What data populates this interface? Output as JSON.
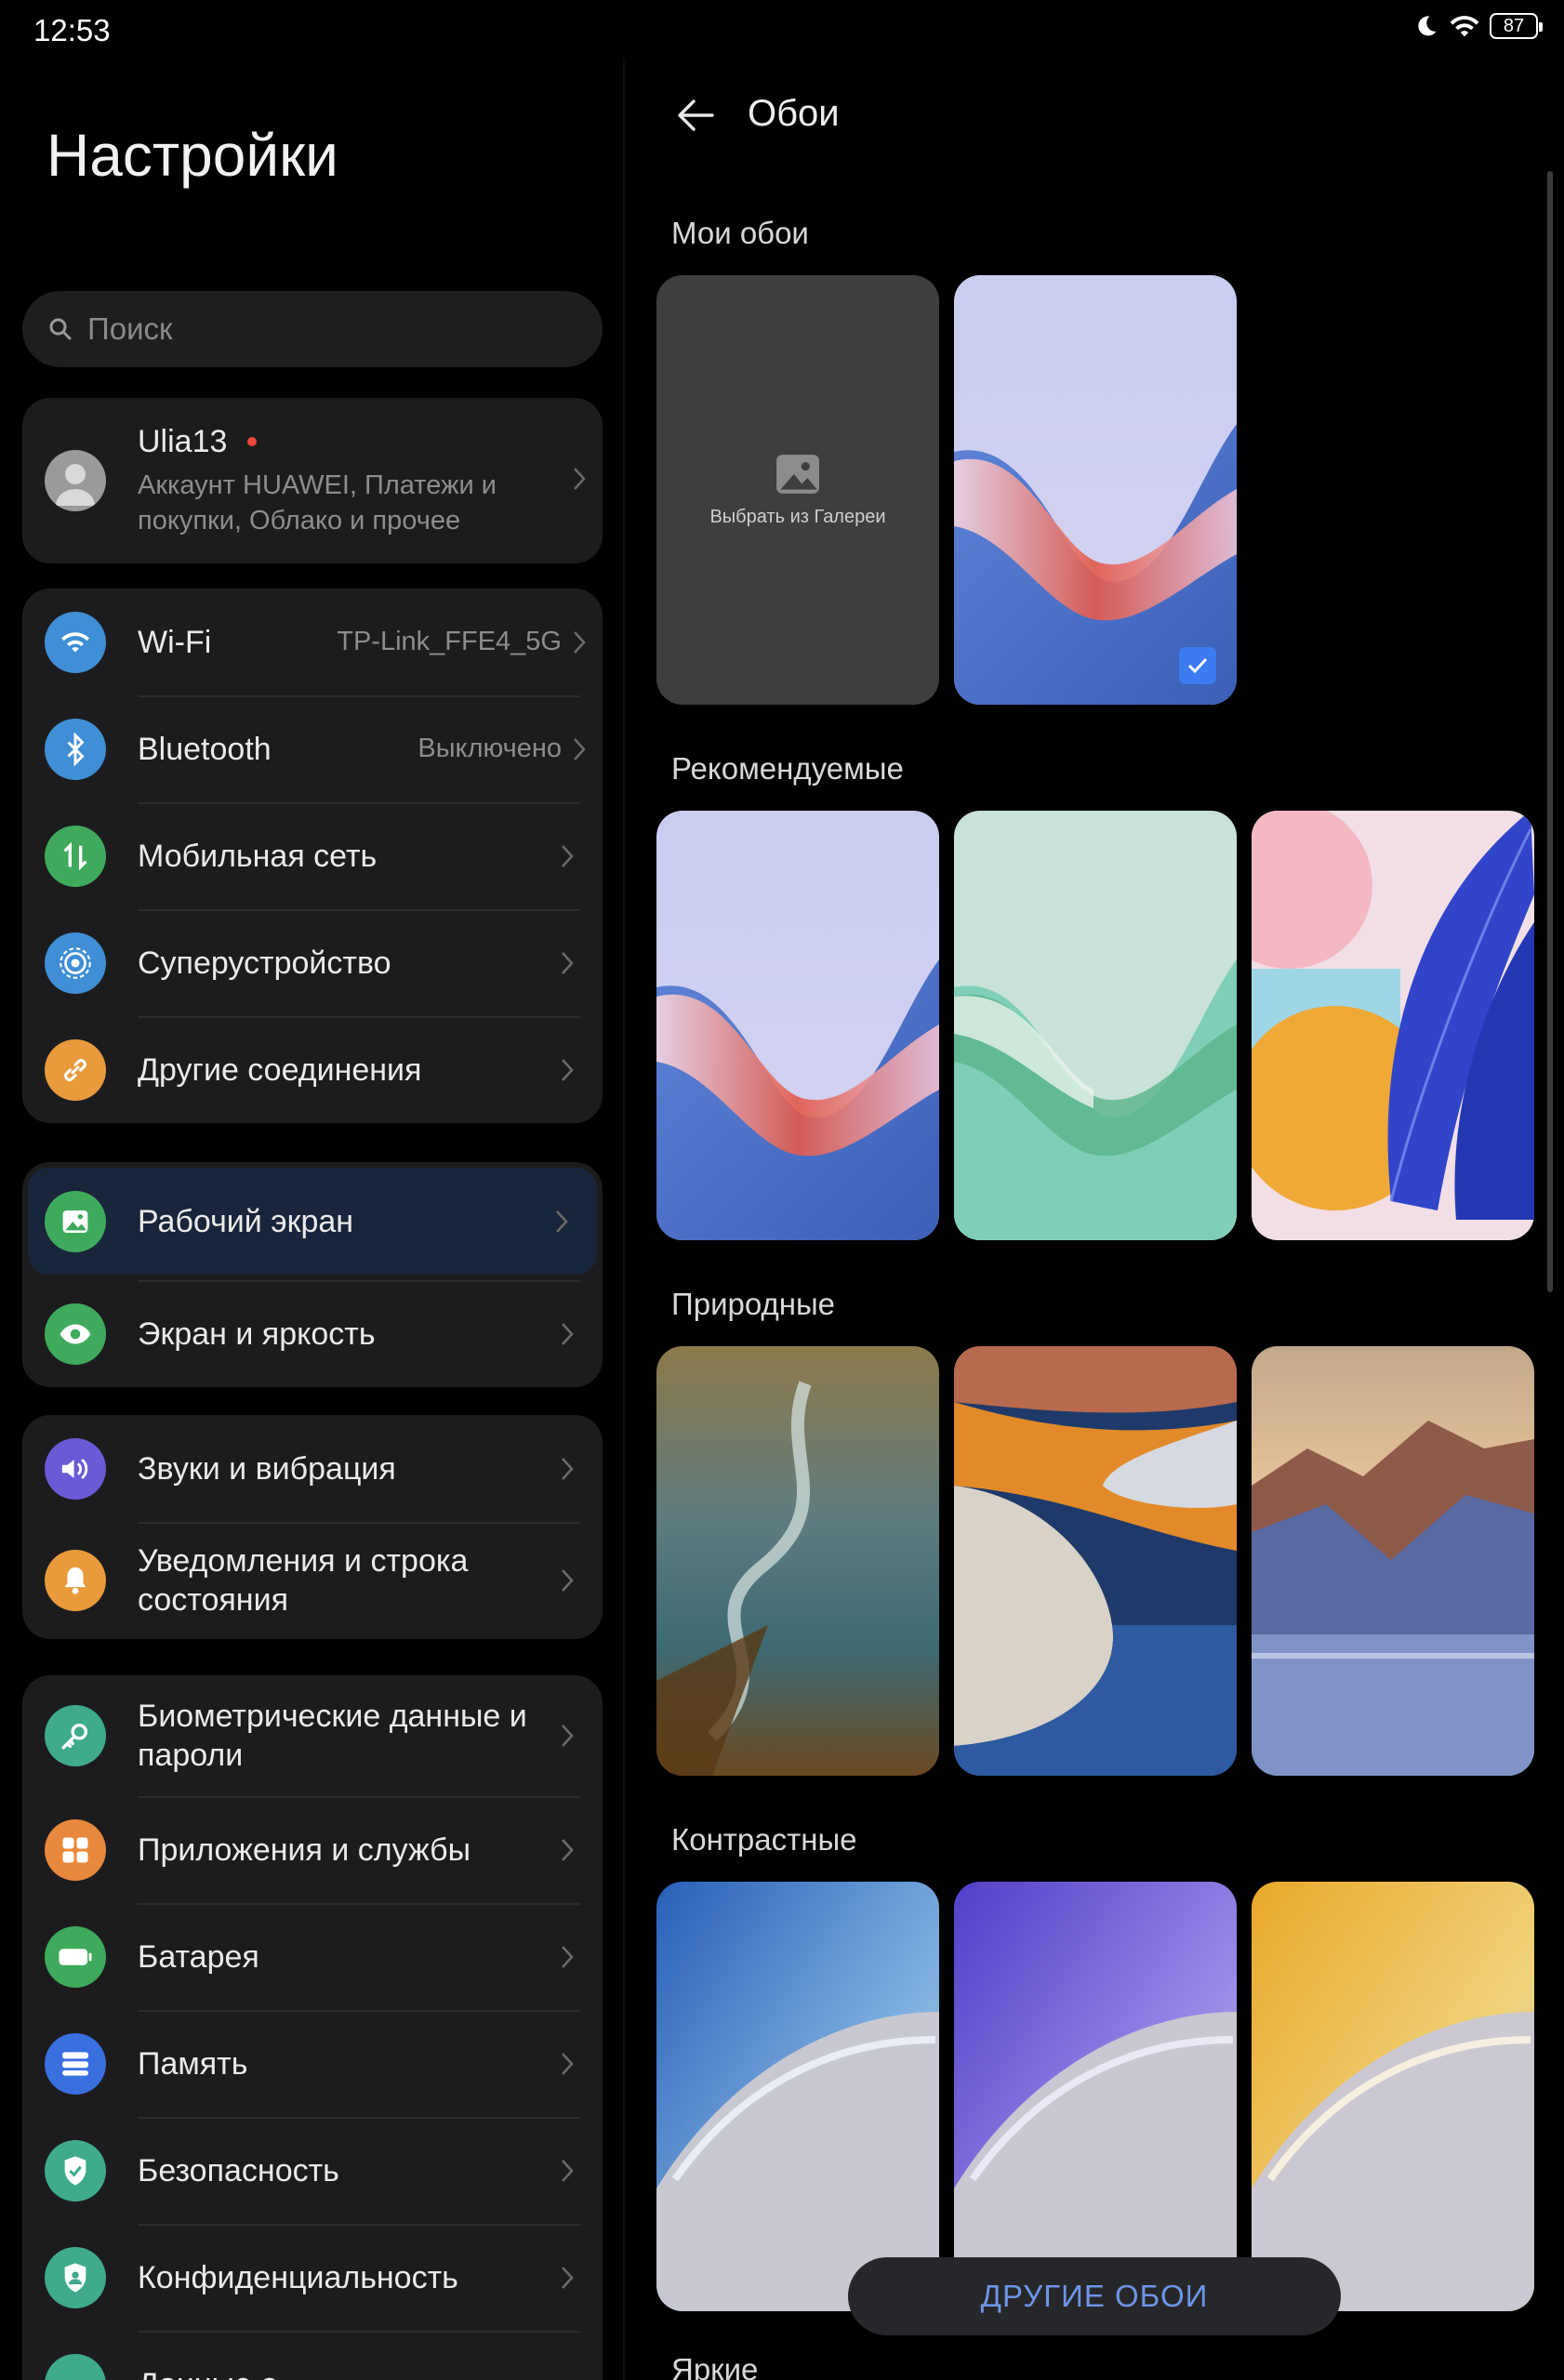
{
  "status": {
    "time": "12:53",
    "battery": "87"
  },
  "settings": {
    "title": "Настройки",
    "search_placeholder": "Поиск",
    "profile": {
      "name": "Ulia13",
      "subtitle_line1": "Аккаунт HUAWEI, Платежи и",
      "subtitle_line2": "покупки, Облако и прочее"
    },
    "items": {
      "wifi": {
        "label": "Wi-Fi",
        "value": "TP-Link_FFE4_5G"
      },
      "bluetooth": {
        "label": "Bluetooth",
        "value": "Выключено"
      },
      "mobile": {
        "label": "Мобильная сеть"
      },
      "super": {
        "label": "Суперустройство"
      },
      "other": {
        "label": "Другие соединения"
      },
      "home": {
        "label": "Рабочий экран"
      },
      "display": {
        "label": "Экран и яркость"
      },
      "sound": {
        "label": "Звуки и вибрация"
      },
      "notif": {
        "label_line1": "Уведомления и строка",
        "label_line2": "состояния"
      },
      "bio": {
        "label_line1": "Биометрические данные и",
        "label_line2": "пароли"
      },
      "apps": {
        "label": "Приложения и службы"
      },
      "battery": {
        "label": "Батарея"
      },
      "memory": {
        "label": "Память"
      },
      "security": {
        "label": "Безопасность"
      },
      "privacy": {
        "label": "Конфиденциальность"
      },
      "data": {
        "label": "Данные о"
      }
    }
  },
  "wallpapers": {
    "title": "Обои",
    "sections": {
      "mine": "Мои обои",
      "recommended": "Рекомендуемые",
      "nature": "Природные",
      "contrast": "Контрастные",
      "bright": "Яркие"
    },
    "gallery_label": "Выбрать из Галереи",
    "more_button": "ДРУГИЕ ОБОИ"
  }
}
